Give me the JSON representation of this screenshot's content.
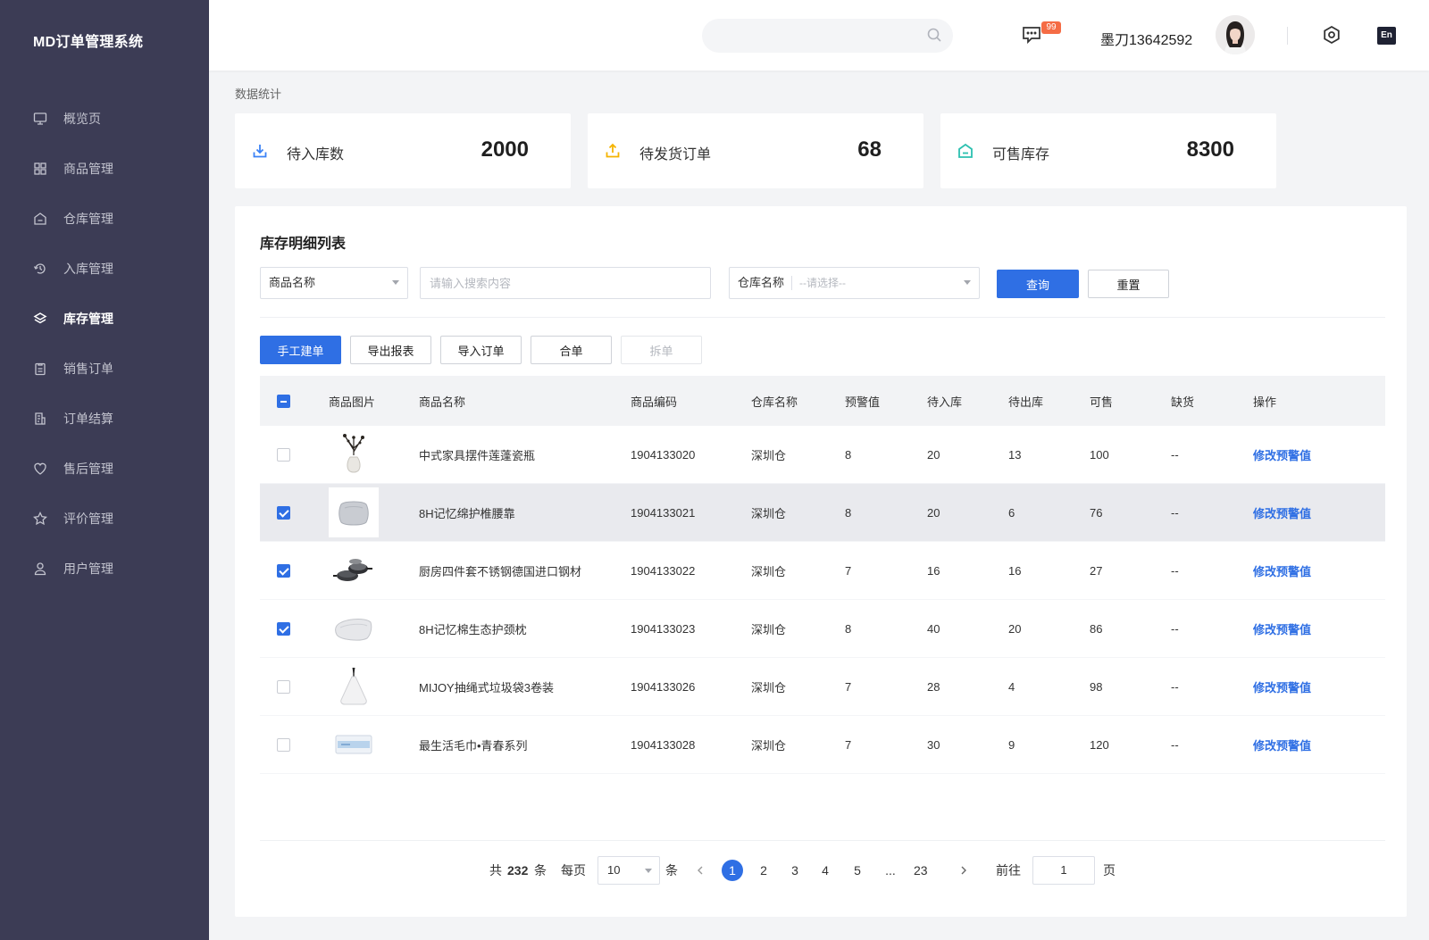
{
  "app": {
    "title": "MD订单管理系统"
  },
  "sidebar": {
    "items": [
      {
        "label": "概览页",
        "icon": "monitor-icon"
      },
      {
        "label": "商品管理",
        "icon": "grid-icon"
      },
      {
        "label": "仓库管理",
        "icon": "warehouse-icon"
      },
      {
        "label": "入库管理",
        "icon": "inbound-icon"
      },
      {
        "label": "库存管理",
        "icon": "layers-icon",
        "active": true
      },
      {
        "label": "销售订单",
        "icon": "clipboard-icon"
      },
      {
        "label": "订单结算",
        "icon": "invoice-icon"
      },
      {
        "label": "售后管理",
        "icon": "heart-icon"
      },
      {
        "label": "评价管理",
        "icon": "star-icon"
      },
      {
        "label": "用户管理",
        "icon": "user-icon"
      }
    ]
  },
  "header": {
    "search_placeholder": "",
    "notification_count": "99",
    "username": "墨刀13642592",
    "lang": "En"
  },
  "stats": {
    "section_label": "数据统计",
    "cards": [
      {
        "label": "待入库数",
        "value": "2000",
        "color": "#3b82f6"
      },
      {
        "label": "待发货订单",
        "value": "68",
        "color": "#f5b400"
      },
      {
        "label": "可售库存",
        "value": "8300",
        "color": "#2cc0b0"
      }
    ]
  },
  "panel": {
    "title": "库存明细列表",
    "filter": {
      "field_select": "商品名称",
      "search_placeholder": "请输入搜索内容",
      "warehouse_label": "仓库名称",
      "warehouse_placeholder": "--请选择--",
      "query_label": "查询",
      "reset_label": "重置"
    },
    "actions": {
      "create": "手工建单",
      "export": "导出报表",
      "import": "导入订单",
      "merge": "合单",
      "split": "拆单"
    },
    "table": {
      "headers": [
        "商品图片",
        "商品名称",
        "商品编码",
        "仓库名称",
        "预警值",
        "待入库",
        "待出库",
        "可售",
        "缺货",
        "操作"
      ],
      "rows": [
        {
          "name": "中式家具摆件莲蓬瓷瓶",
          "code": "1904133020",
          "warehouse": "深圳仓",
          "warn": "8",
          "in": "20",
          "out": "13",
          "sale": "100",
          "short": "--",
          "op": "修改预警值",
          "checked": false
        },
        {
          "name": "8H记忆绵护椎腰靠",
          "code": "1904133021",
          "warehouse": "深圳仓",
          "warn": "8",
          "in": "20",
          "out": "6",
          "sale": "76",
          "short": "--",
          "op": "修改预警值",
          "checked": true
        },
        {
          "name": "厨房四件套不锈钢德国进口钢材",
          "code": "1904133022",
          "warehouse": "深圳仓",
          "warn": "7",
          "in": "16",
          "out": "16",
          "sale": "27",
          "short": "--",
          "op": "修改预警值",
          "checked": true
        },
        {
          "name": "8H记忆棉生态护颈枕",
          "code": "1904133023",
          "warehouse": "深圳仓",
          "warn": "8",
          "in": "40",
          "out": "20",
          "sale": "86",
          "short": "--",
          "op": "修改预警值",
          "checked": true
        },
        {
          "name": "MIJOY抽绳式垃圾袋3卷装",
          "code": "1904133026",
          "warehouse": "深圳仓",
          "warn": "7",
          "in": "28",
          "out": "4",
          "sale": "98",
          "short": "--",
          "op": "修改预警值",
          "checked": false
        },
        {
          "name": "最生活毛巾•青春系列",
          "code": "1904133028",
          "warehouse": "深圳仓",
          "warn": "7",
          "in": "30",
          "out": "9",
          "sale": "120",
          "short": "--",
          "op": "修改预警值",
          "checked": false
        }
      ]
    },
    "pagination": {
      "total_prefix": "共",
      "total": "232",
      "total_suffix": "条",
      "per_page_label": "每页",
      "per_page": "10",
      "per_page_suffix": "条",
      "pages": [
        "1",
        "2",
        "3",
        "4",
        "5"
      ],
      "ellipsis": "...",
      "last_page": "23",
      "current_page": "1",
      "goto_label": "前往",
      "goto_value": "1",
      "goto_suffix": "页"
    }
  }
}
